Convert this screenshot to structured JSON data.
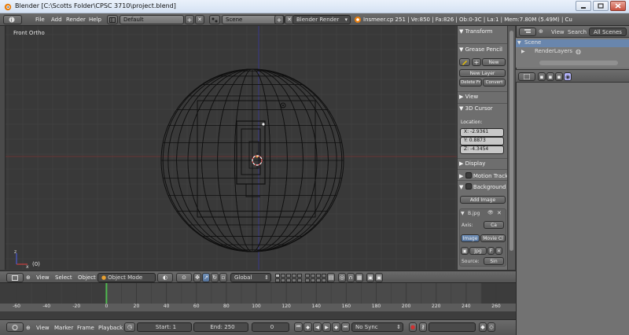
{
  "window": {
    "title": "Blender [C:\\Scotts Folder\\CPSC 3710\\project.blend]"
  },
  "info_header": {
    "menus": [
      "File",
      "Add",
      "Render",
      "Help"
    ],
    "screen_layout": "Default",
    "scene": "Scene",
    "render_engine": "Blender Render",
    "stats": "Insmeer.cp 251 | Ve:850 | Fa:826 | Ob:0-3C | La:1 | Mem:7.80M (5.49M) | Cu"
  },
  "viewport": {
    "view_label": "Front Ortho",
    "object_label": "(0)"
  },
  "npanel": {
    "transform": "Transform",
    "grease_pencil": "Grease Pencil",
    "new_label": "New",
    "new_layer": "New Layer",
    "delete_frame": "Delete Fr",
    "convert": "Convert",
    "view": "View",
    "cursor_3d": "3D Cursor",
    "location": "Location:",
    "x": "X: -2.9361",
    "y": "Y: 0.8873",
    "z": "Z: -4.3454",
    "display": "Display",
    "motion_tracking": "Motion Track",
    "background_images": "Background I",
    "add_image": "Add Image",
    "image_name": "B.jpg",
    "axis_label": "Axis:",
    "axis_value": "Ca",
    "image_tab": "Image",
    "movie_clip_tab": "Movie Cl",
    "image_file": "Jpg",
    "source_label": "Source:",
    "source_value": "Sin"
  },
  "outliner": {
    "view": "View",
    "search": "Search",
    "all_scenes": "All Scenes",
    "scene": "Scene",
    "render_layers": "RenderLayers"
  },
  "view3d_header": {
    "view": "View",
    "select": "Select",
    "object": "Object",
    "mode": "Object Mode",
    "orientation": "Global"
  },
  "timeline": {
    "ticks": [
      "-60",
      "-40",
      "-20",
      "0",
      "20",
      "40",
      "60",
      "80",
      "100",
      "120",
      "140",
      "160",
      "180",
      "200",
      "220",
      "240",
      "260"
    ],
    "current_frame_value": 0
  },
  "timeline_header": {
    "view": "View",
    "marker": "Marker",
    "frame": "Frame",
    "playback": "Playback",
    "start": "Start: 1",
    "end": "End: 250",
    "current": "0",
    "sync": "No Sync"
  },
  "colors": {
    "viewport_bg": "#393939",
    "grid": "#444444",
    "wire": "#101010",
    "x_axis": "#7a3535",
    "z_axis": "#3a3a9a",
    "frame_line": "#4fb94f"
  }
}
